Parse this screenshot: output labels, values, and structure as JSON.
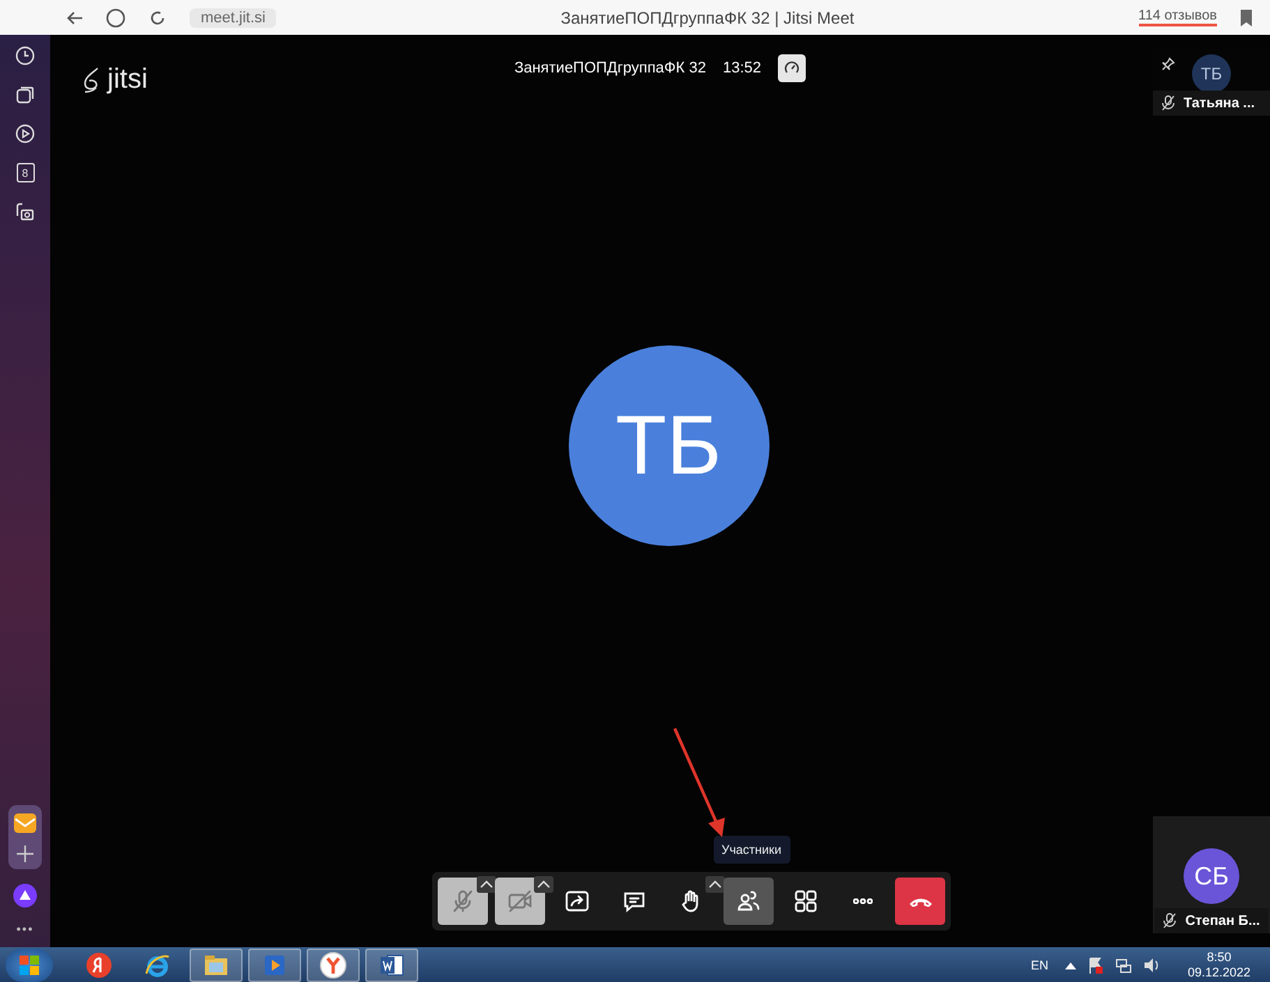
{
  "browser": {
    "address": "meet.jit.si",
    "title": "ЗанятиеПОПДгруппаФК 32 | Jitsi Meet",
    "reviews": "114 отзывов"
  },
  "sidebar": {
    "top_icons": [
      {
        "kind": "clock"
      },
      {
        "kind": "cards"
      },
      {
        "kind": "play"
      },
      {
        "kind": "counter",
        "label": "8"
      },
      {
        "kind": "camera"
      }
    ],
    "more": "•••"
  },
  "meeting": {
    "logo": "jitsi",
    "subject": "ЗанятиеПОПДгруппаФК 32",
    "timer": "13:52",
    "speaker_initials": "ТБ"
  },
  "tiles": [
    {
      "initials": "ТБ",
      "name": "Татьяна ...",
      "pinned_icon": true,
      "color": "#1f3458"
    },
    {
      "initials": "СБ",
      "name": "Степан Б...",
      "pinned_icon": false,
      "color": "#6a55d8"
    }
  ],
  "tooltip": "Участники",
  "toolbar": [
    {
      "kind": "mic",
      "muted": true,
      "selected": false,
      "has_menu": true
    },
    {
      "kind": "camera",
      "muted": true,
      "selected": false,
      "has_menu": true
    },
    {
      "kind": "share",
      "muted": false,
      "selected": false,
      "has_menu": false
    },
    {
      "kind": "chat",
      "muted": false,
      "selected": false,
      "has_menu": false
    },
    {
      "kind": "hand",
      "muted": false,
      "selected": false,
      "has_menu": true
    },
    {
      "kind": "participants",
      "muted": false,
      "selected": true,
      "has_menu": false
    },
    {
      "kind": "tiles",
      "muted": false,
      "selected": false,
      "has_menu": false
    },
    {
      "kind": "more",
      "muted": false,
      "selected": false,
      "has_menu": false
    },
    {
      "kind": "hangup",
      "muted": false,
      "selected": false,
      "has_menu": false
    }
  ],
  "taskbar": {
    "apps": [
      {
        "kind": "yandex",
        "active": false
      },
      {
        "kind": "ie",
        "active": false
      },
      {
        "kind": "folder",
        "active": true
      },
      {
        "kind": "media",
        "active": true
      },
      {
        "kind": "ybrowser",
        "active": true
      },
      {
        "kind": "word",
        "active": true
      }
    ],
    "language": "EN",
    "time": "8:50",
    "date": "09.12.2022"
  }
}
